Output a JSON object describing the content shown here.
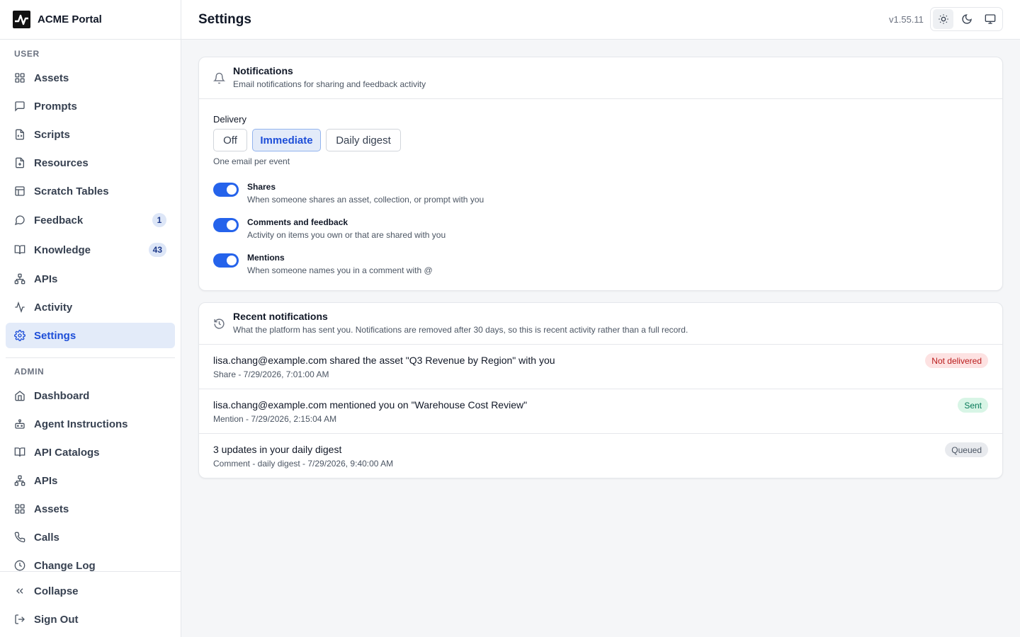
{
  "app": {
    "name": "ACME Portal"
  },
  "sidebar": {
    "user_label": "USER",
    "admin_label": "ADMIN",
    "user_items": [
      {
        "label": "Assets",
        "icon": "grid-icon"
      },
      {
        "label": "Prompts",
        "icon": "message-square-icon"
      },
      {
        "label": "Scripts",
        "icon": "file-code-icon"
      },
      {
        "label": "Resources",
        "icon": "file-plus-icon"
      },
      {
        "label": "Scratch Tables",
        "icon": "table-icon"
      },
      {
        "label": "Feedback",
        "icon": "message-circle-icon",
        "count": "1"
      },
      {
        "label": "Knowledge",
        "icon": "book-open-icon",
        "count": "43"
      },
      {
        "label": "APIs",
        "icon": "network-icon"
      },
      {
        "label": "Activity",
        "icon": "activity-icon"
      },
      {
        "label": "Settings",
        "icon": "gear-icon",
        "active": true
      }
    ],
    "admin_items": [
      {
        "label": "Dashboard",
        "icon": "home-icon"
      },
      {
        "label": "Agent Instructions",
        "icon": "bot-icon"
      },
      {
        "label": "API Catalogs",
        "icon": "book-open-icon"
      },
      {
        "label": "APIs",
        "icon": "network-icon"
      },
      {
        "label": "Assets",
        "icon": "grid-icon"
      },
      {
        "label": "Calls",
        "icon": "phone-icon"
      },
      {
        "label": "Change Log",
        "icon": "clock-icon"
      }
    ],
    "collapse_label": "Collapse",
    "signout_label": "Sign Out"
  },
  "header": {
    "title": "Settings",
    "version": "v1.55.11",
    "theme_modes": [
      "light",
      "dark",
      "system"
    ],
    "active_theme": "light"
  },
  "notifications": {
    "title": "Notifications",
    "subtitle": "Email notifications for sharing and feedback activity",
    "delivery_label": "Delivery",
    "delivery_options": [
      "Off",
      "Immediate",
      "Daily digest"
    ],
    "delivery_selected": "Immediate",
    "delivery_hint": "One email per event",
    "options": [
      {
        "title": "Shares",
        "desc": "When someone shares an asset, collection, or prompt with you",
        "enabled": true
      },
      {
        "title": "Comments and feedback",
        "desc": "Activity on items you own or that are shared with you",
        "enabled": true
      },
      {
        "title": "Mentions",
        "desc": "When someone names you in a comment with @",
        "enabled": true
      }
    ]
  },
  "recent": {
    "title": "Recent notifications",
    "subtitle": "What the platform has sent you. Notifications are removed after 30 days, so this is recent activity rather than a full record.",
    "items": [
      {
        "message": "lisa.chang@example.com shared the asset \"Q3 Revenue by Region\" with you",
        "meta": "Share - 7/29/2026, 7:01:00 AM",
        "status": "Not delivered"
      },
      {
        "message": "lisa.chang@example.com mentioned you on \"Warehouse Cost Review\"",
        "meta": "Mention - 7/29/2026, 2:15:04 AM",
        "status": "Sent"
      },
      {
        "message": "3 updates in your daily digest",
        "meta": "Comment - daily digest - 7/29/2026, 9:40:00 AM",
        "status": "Queued"
      }
    ]
  },
  "colors": {
    "accent": "#2563eb",
    "active_bg": "#e3ebf9",
    "error": "#b91c1c",
    "success": "#047857"
  }
}
